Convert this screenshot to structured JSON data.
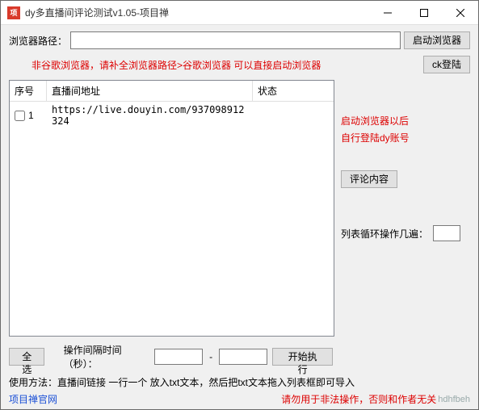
{
  "window": {
    "icon_text": "项",
    "title": "dy多直播间评论测试v1.05-项目禅"
  },
  "row1": {
    "label": "浏览器路径：",
    "path_value": "",
    "launch_btn": "启动浏览器"
  },
  "warn": "非谷歌浏览器，请补全浏览器路径>谷歌浏览器 可以直接启动浏览器",
  "ck_btn": "ck登陆",
  "headers": {
    "idx": "序号",
    "url": "直播间地址",
    "state": "状态"
  },
  "rows": [
    {
      "idx": "1",
      "checked": false,
      "url": "https://live.douyin.com/937098912324",
      "state": ""
    }
  ],
  "side": {
    "hint1": "启动浏览器以后",
    "hint2": "自行登陆dy账号",
    "comment_btn": "评论内容",
    "loop_label": "列表循环操作几遍：",
    "loop_value": ""
  },
  "bottom": {
    "select_all": "全选",
    "interval_label": "操作间隔时间（秒）：",
    "t1": "",
    "t2": "",
    "start_btn": "开始执行"
  },
  "usage": "使用方法：直播间链接 一行一个 放入txt文本，然后把txt文本拖入列表框即可导入",
  "footer": {
    "link": "项目禅官网",
    "legal": "请勿用于非法操作，否则和作者无关",
    "wm": "hdhfbeh"
  }
}
